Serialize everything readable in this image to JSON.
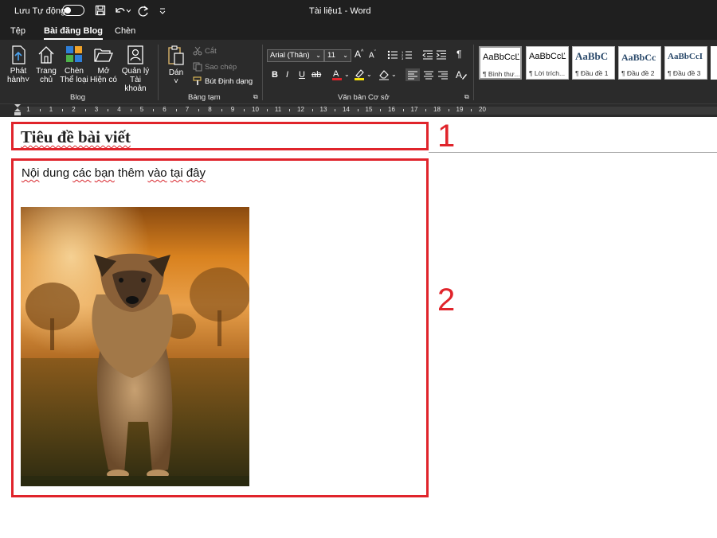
{
  "titlebar": {
    "autosave_label": "Lưu Tự động",
    "document_title": "Tài liệu1  -  Word"
  },
  "tabs": [
    {
      "label": "Tệp"
    },
    {
      "label": "Bài đăng Blog",
      "active": true
    },
    {
      "label": "Chèn"
    }
  ],
  "ribbon": {
    "blog": {
      "publish_line1": "Phát",
      "publish_line2": "hành",
      "home_line1": "Trang",
      "home_line2": "chủ",
      "insert_category_line1": "Chèn",
      "insert_category_line2": "Thể loại",
      "open_existing_line1": "Mở",
      "open_existing_line2": "Hiện có",
      "manage_accounts_line1": "Quản lý",
      "manage_accounts_line2": "Tài khoản",
      "group_label": "Blog"
    },
    "clipboard": {
      "paste": "Dán",
      "cut": "Cắt",
      "copy": "Sao chép",
      "format_painter": "Bút Định dạng",
      "group_label": "Bảng tạm"
    },
    "basic_text": {
      "font_name": "Arial (Thân)",
      "font_size": "11",
      "bold": "B",
      "italic": "I",
      "underline": "U",
      "strike": "ab",
      "group_label": "Văn bản Cơ sở"
    },
    "styles": [
      {
        "sample": "AaBbCcĽ",
        "name": "¶ Bình thư...",
        "selected": true
      },
      {
        "sample": "AaBbCcĽ",
        "name": "¶ Lời trích..."
      },
      {
        "sample": "AaBbC",
        "name": "¶ Đầu đề 1"
      },
      {
        "sample": "AaBbCc",
        "name": "¶ Đầu đề 2"
      },
      {
        "sample": "AaBbCcI",
        "name": "¶ Đầu đề 3"
      }
    ]
  },
  "ruler": {
    "ticks": [
      "1",
      "1",
      "2",
      "3",
      "4",
      "5",
      "6",
      "7",
      "8",
      "9",
      "10",
      "11",
      "12",
      "13",
      "14",
      "15",
      "16",
      "17",
      "18",
      "19",
      "20"
    ]
  },
  "document": {
    "title": "Tiêu đề bài viết",
    "body_words": [
      "Nội",
      " dung ",
      "các",
      " ",
      "bạn",
      " thêm ",
      "vào",
      " ",
      "tại",
      " ",
      "đây"
    ],
    "annotation_1": "1",
    "annotation_2": "2"
  },
  "colors": {
    "chrome": "#1f1f1f",
    "ribbon": "#2b2b2b",
    "highlight_box": "#e0242b"
  }
}
